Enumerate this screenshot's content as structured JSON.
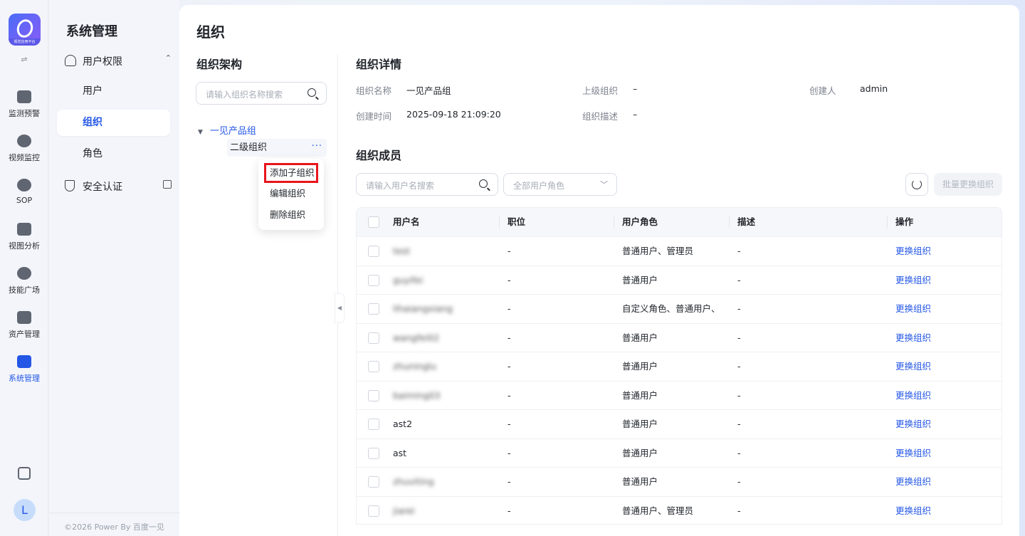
{
  "rail": {
    "logo_caption": "视觉应用平台",
    "toggle": "⇌",
    "items": [
      {
        "label": "监测预警"
      },
      {
        "label": "视频监控"
      },
      {
        "label": "SOP"
      },
      {
        "label": "视图分析"
      },
      {
        "label": "技能广场"
      },
      {
        "label": "资产管理"
      },
      {
        "label": "系统管理",
        "active": true
      }
    ],
    "avatar": "L"
  },
  "subnav": {
    "title": "系统管理",
    "group_label": "用户权限",
    "group_chevron": "⌃",
    "sub_items": [
      "用户",
      "组织",
      "角色"
    ],
    "active_sub": "组织",
    "security_label": "安全认证",
    "copyright": "©2026 Power By 百度一见"
  },
  "page": {
    "title": "组织"
  },
  "tree": {
    "title": "组织架构",
    "search_placeholder": "请输入组织名称搜索",
    "root": "一见产品组",
    "child": "二级组织",
    "more": "···",
    "menu": [
      "添加子组织",
      "编辑组织",
      "删除组织"
    ],
    "collapse": "◀"
  },
  "detail": {
    "title": "组织详情",
    "fields": {
      "name_label": "组织名称",
      "name_value": "一见产品组",
      "parent_label": "上级组织",
      "parent_value": "–",
      "creator_label": "创建人",
      "creator_value": "admin",
      "created_label": "创建时间",
      "created_value": "2025-09-18 21:09:20",
      "desc_label": "组织描述",
      "desc_value": "–"
    }
  },
  "members": {
    "title": "组织成员",
    "search_placeholder": "请输入用户名搜索",
    "role_select_placeholder": "全部用户角色",
    "batch_button": "批量更换组织",
    "columns": [
      "用户名",
      "职位",
      "用户角色",
      "描述",
      "操作"
    ],
    "rows": [
      {
        "username": "test",
        "blurred": true,
        "position": "-",
        "roles": "普通用户、管理员",
        "desc": "-",
        "action": "更换组织"
      },
      {
        "username": "guyifei",
        "blurred": true,
        "position": "-",
        "roles": "普通用户",
        "desc": "-",
        "action": "更换组织"
      },
      {
        "username": "lihaiangxiang",
        "blurred": true,
        "position": "-",
        "roles": "自定义角色、普通用户、管",
        "desc": "-",
        "action": "更换组织"
      },
      {
        "username": "wangfei02",
        "blurred": true,
        "position": "-",
        "roles": "普通用户",
        "desc": "-",
        "action": "更换组织"
      },
      {
        "username": "zhuninglu",
        "blurred": true,
        "position": "-",
        "roles": "普通用户",
        "desc": "-",
        "action": "更换组织"
      },
      {
        "username": "baiming03",
        "blurred": true,
        "position": "-",
        "roles": "普通用户",
        "desc": "-",
        "action": "更换组织"
      },
      {
        "username": "ast2",
        "blurred": false,
        "position": "-",
        "roles": "普通用户",
        "desc": "-",
        "action": "更换组织"
      },
      {
        "username": "ast",
        "blurred": false,
        "position": "-",
        "roles": "普通用户",
        "desc": "-",
        "action": "更换组织"
      },
      {
        "username": "zhuviting",
        "blurred": true,
        "position": "-",
        "roles": "普通用户",
        "desc": "-",
        "action": "更换组织"
      },
      {
        "username": "jiarei",
        "blurred": true,
        "position": "-",
        "roles": "普通用户、管理员",
        "desc": "-",
        "action": "更换组织"
      }
    ]
  },
  "colors": {
    "accent": "#2457e6",
    "highlight_box": "#e8141b"
  }
}
